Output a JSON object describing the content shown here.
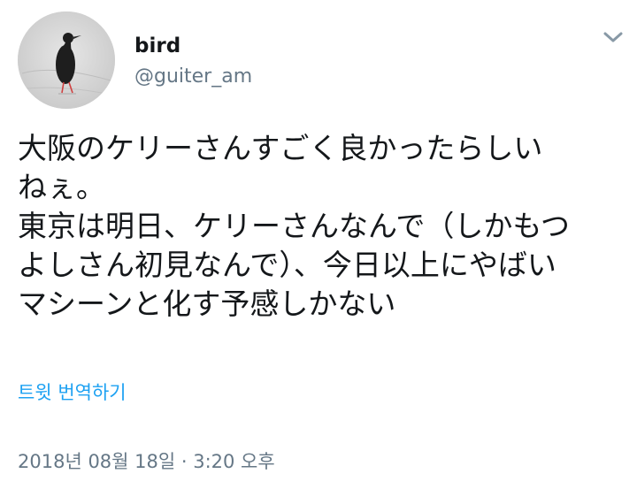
{
  "author": {
    "display_name": "bird",
    "handle": "@guiter_am"
  },
  "tweet": {
    "lines": [
      "大阪のケリーさんすごく良かったらしい",
      "ねぇ。",
      "東京は明日、ケリーさんなんで（しかもつ",
      "よしさん初見なんで）、今日以上にやばい",
      "マシーンと化す予感しかない"
    ],
    "translate_label": "트윗 번역하기",
    "timestamp": "2018년 08월 18일 · 3:20 오후"
  },
  "icons": {
    "menu": "chevron-down-icon",
    "avatar": "bird-photo"
  },
  "colors": {
    "link": "#1da1f2",
    "secondary_text": "#657786",
    "primary_text": "#14171a"
  }
}
